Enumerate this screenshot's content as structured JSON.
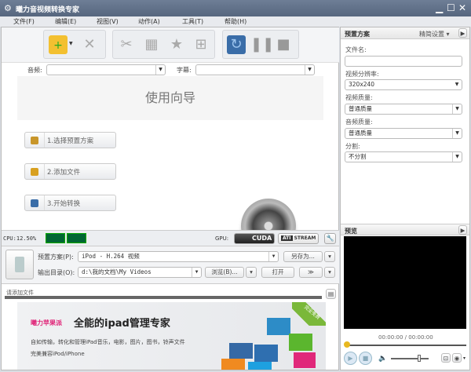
{
  "window": {
    "title": "曦力音视频转换专家",
    "minimize": "▁",
    "maximize": "☐",
    "close": "✕"
  },
  "menu": [
    "文件(F)",
    "编辑(E)",
    "视图(V)",
    "动作(A)",
    "工具(T)",
    "帮助(H)"
  ],
  "toolbar": {
    "icons": [
      "add-file-icon",
      "delete-icon",
      "cut-icon",
      "crop-icon",
      "effect-icon",
      "merge-icon",
      "convert-icon",
      "pause-icon",
      "stop-icon"
    ]
  },
  "tracks": {
    "audio_label": "音频:",
    "audio_value": "",
    "subtitle_label": "字幕:",
    "subtitle_value": ""
  },
  "wizard": {
    "title": "使用向导",
    "steps": [
      "1.选择预置方案",
      "2.添加文件",
      "3.开始转换"
    ]
  },
  "status": {
    "cpu": "CPU:12.50%",
    "gpu_label": "GPU:",
    "cuda": "CUDA",
    "stream": "STREAM",
    "ati": "ATI"
  },
  "output": {
    "preset_label": "预置方案(P):",
    "preset_value": "iPod - H.264 视频",
    "save_as": "另存为...",
    "dir_label": "输出目录(O):",
    "dir_value": "d:\\我的文档\\My Videos",
    "browse": "浏览(B)...",
    "open": "打开",
    "transfer": "≫"
  },
  "tasks": {
    "hint": "请添加文件"
  },
  "banner": {
    "brand": "曦力苹果派",
    "headline": "全能的ipad管理专家",
    "line1": "自如传输，转化和管理iPad音乐，电影，图片，图书，铃声文件",
    "line2": "完美兼容iPod/iPhone",
    "ribbon": "完全免费"
  },
  "settings": {
    "header": "预置方案",
    "mode": "精简设置",
    "filename_label": "文件名:",
    "filename_value": "",
    "resolution_label": "视频分辨率:",
    "resolution_value": "320x240",
    "vquality_label": "视频质量:",
    "vquality_value": "普通质量",
    "aquality_label": "音频质量:",
    "aquality_value": "普通质量",
    "split_label": "分割:",
    "split_value": "不分割"
  },
  "preview": {
    "header": "预览",
    "time": "00:00:00 / 00:00:00",
    "progress": 0,
    "volume": 0.75
  },
  "colors": {
    "titlebar": "#5a6a82",
    "convert": "#3a6da8",
    "banner_brand": "#e0287a",
    "ribbon": "#7ab83a"
  }
}
